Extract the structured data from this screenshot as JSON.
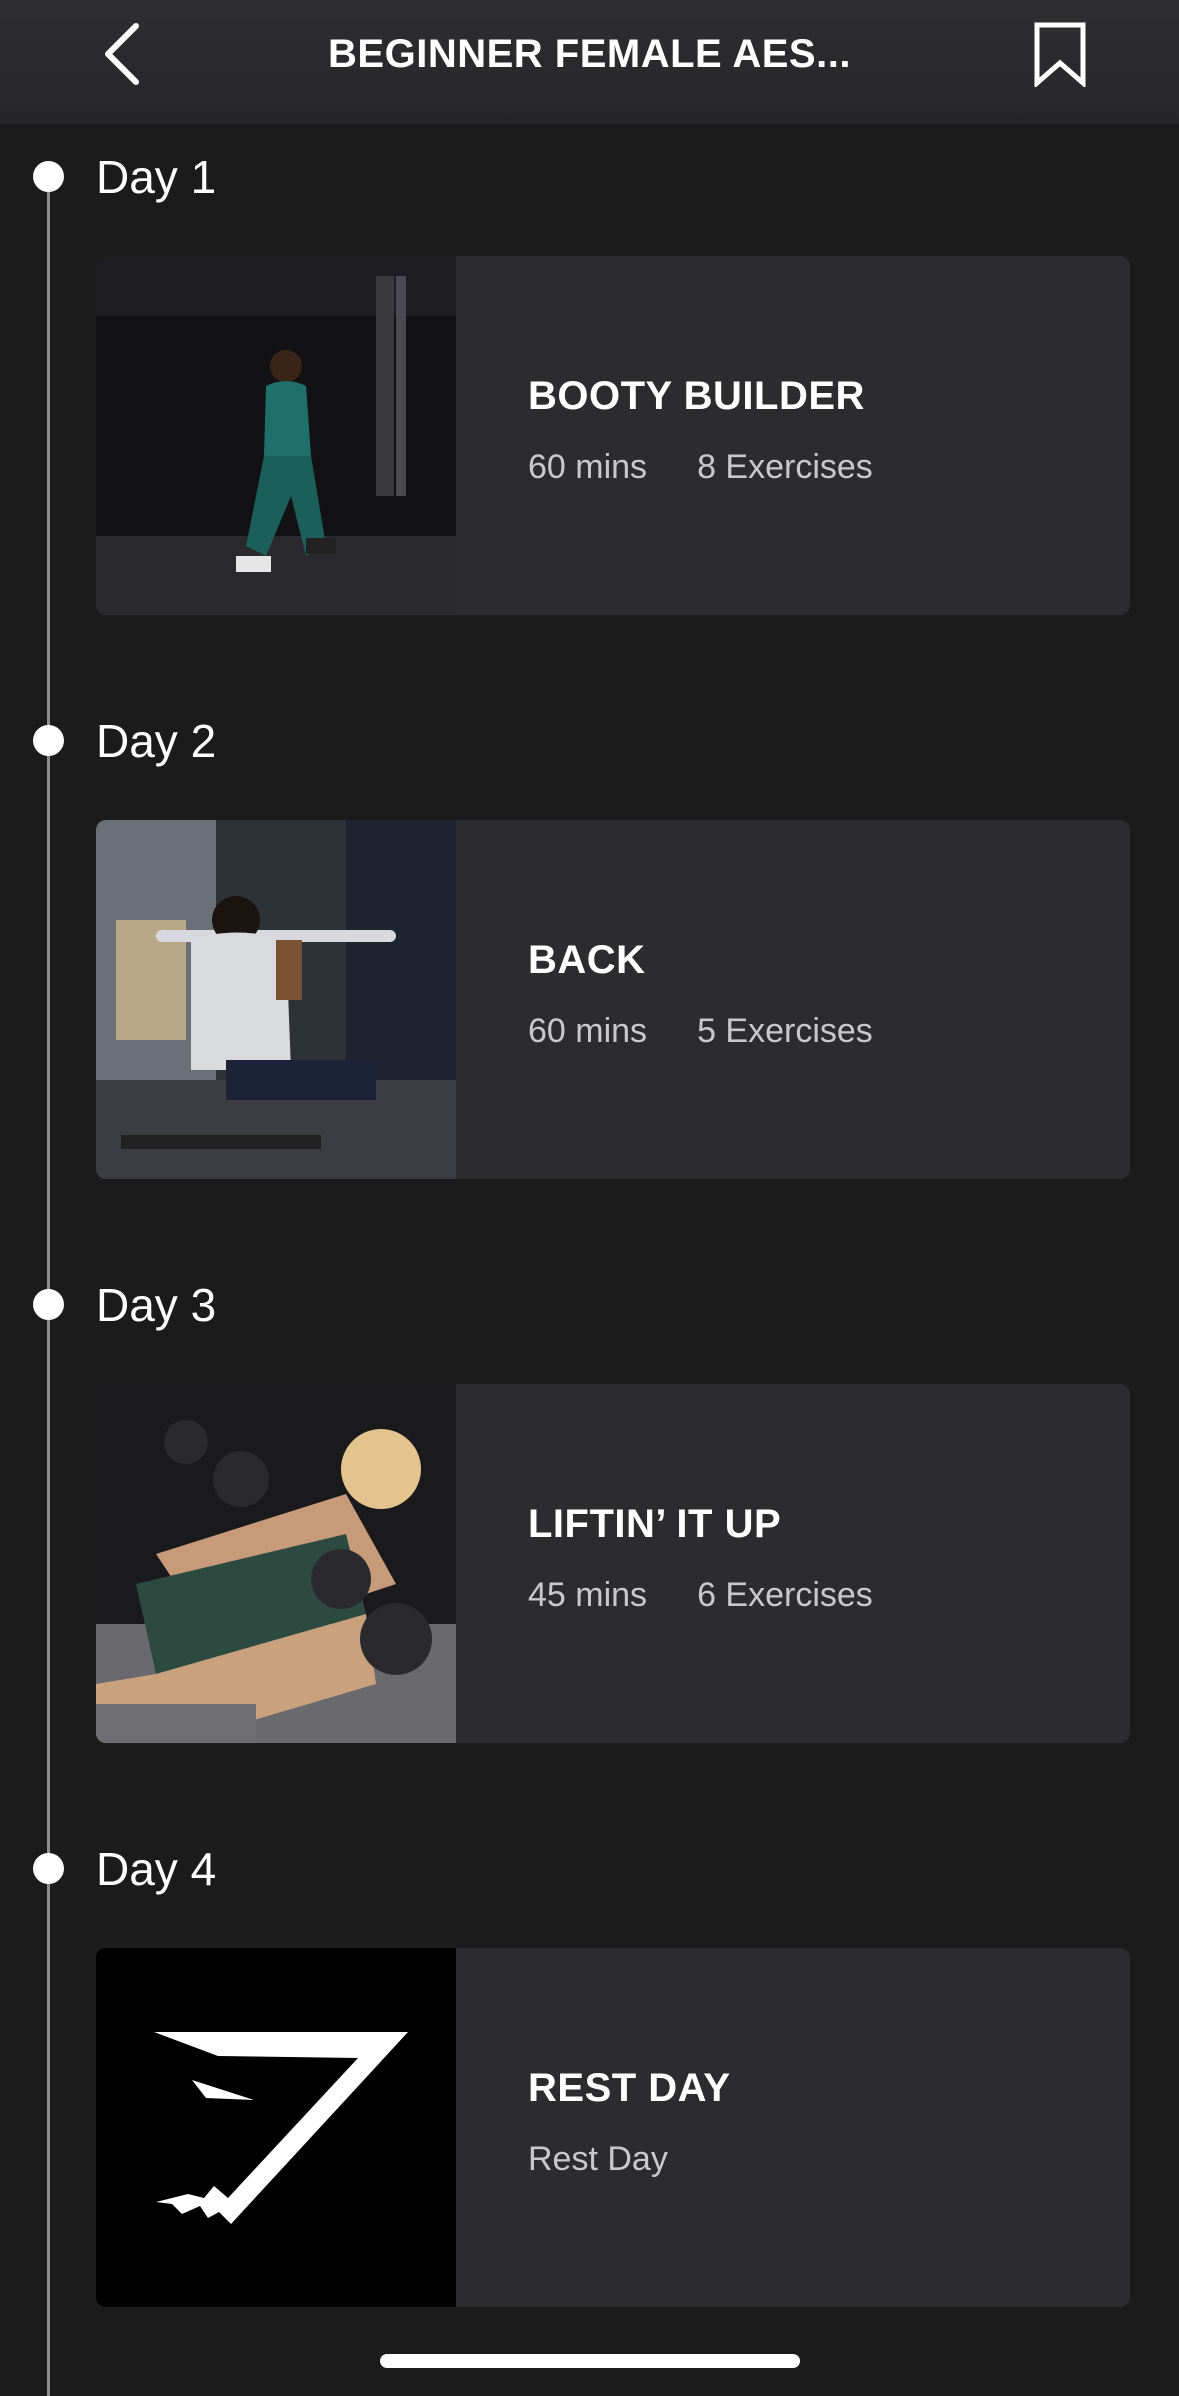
{
  "header": {
    "title": "BEGINNER FEMALE AES...",
    "back_icon": "chevron-left-icon",
    "bookmark_icon": "bookmark-icon"
  },
  "days": [
    {
      "label": "Day 1",
      "workout": {
        "title": "BOOTY BUILDER",
        "duration": "60 mins",
        "exercises": "8 Exercises",
        "image": "gym-lunge-photo"
      }
    },
    {
      "label": "Day 2",
      "workout": {
        "title": "BACK",
        "duration": "60 mins",
        "exercises": "5 Exercises",
        "image": "lat-pulldown-photo"
      }
    },
    {
      "label": "Day 3",
      "workout": {
        "title": "LIFTIN’ IT UP",
        "duration": "45 mins",
        "exercises": "6 Exercises",
        "image": "dumbbell-press-photo"
      }
    },
    {
      "label": "Day 4",
      "workout": {
        "title": "REST DAY",
        "duration": "Rest Day",
        "exercises": "",
        "image": "gymshark-logo"
      }
    }
  ],
  "colors": {
    "background": "#1b1b1c",
    "card": "#2c2c2e",
    "timeline": "#8d8d8f",
    "text_secondary": "#c9c9cc"
  }
}
